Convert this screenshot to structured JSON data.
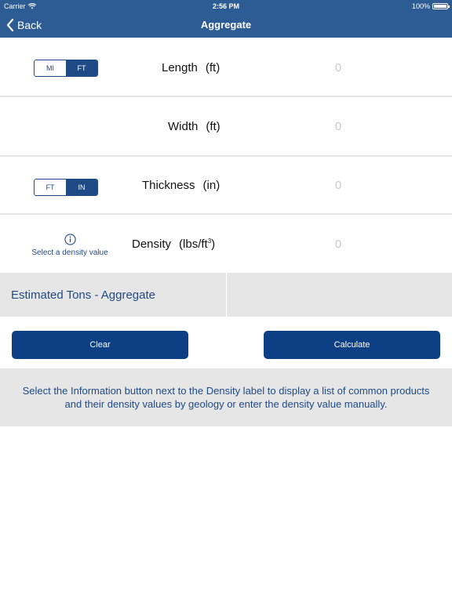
{
  "status_bar": {
    "carrier": "Carrier",
    "time": "2:56 PM",
    "battery": "100%"
  },
  "nav": {
    "back_label": "Back",
    "title": "Aggregate"
  },
  "colors": {
    "header": "#2d5b94",
    "accent": "#0d3f84",
    "value_placeholder": "#c8c8c8",
    "panel": "#e6e6e6"
  },
  "rows": {
    "length": {
      "label": "Length",
      "unit": "(ft)",
      "value": "0",
      "toggle": {
        "options": [
          "MI",
          "FT"
        ],
        "selected": "FT"
      }
    },
    "width": {
      "label": "Width",
      "unit": "(ft)",
      "value": "0"
    },
    "thickness": {
      "label": "Thickness",
      "unit": "(in)",
      "value": "0",
      "toggle": {
        "options": [
          "FT",
          "IN"
        ],
        "selected": "IN"
      }
    },
    "density": {
      "label": "Density",
      "unit_open": "(lbs/ft",
      "unit_sup": "3",
      "unit_close": ")",
      "value": "0",
      "info_text": "Select a density value",
      "info_icon": "info-icon"
    }
  },
  "result": {
    "label": "Estimated Tons - Aggregate",
    "value": ""
  },
  "buttons": {
    "clear": "Clear",
    "calculate": "Calculate"
  },
  "help": {
    "line1": "Select the Information button next to the Density label to display a list of common products",
    "line2": "and their density values by geology or enter the density value manually."
  }
}
